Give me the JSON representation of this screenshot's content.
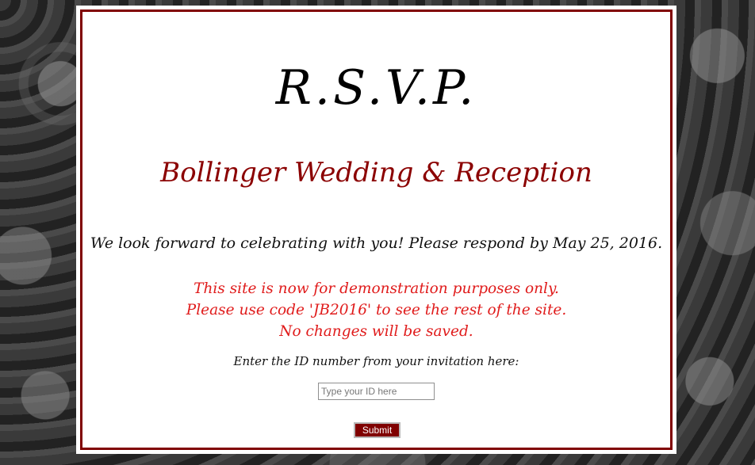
{
  "header": {
    "rsvp_title": "R.S.V.P.",
    "event_title": "Bollinger Wedding  & Reception"
  },
  "main": {
    "message": "We look forward to celebrating with you! Please respond by May 25, 2016.",
    "notice_lines": [
      "This site is now for demonstration purposes only.",
      "Please use code 'JB2016' to see the rest of the site.",
      "No changes will be saved."
    ],
    "prompt": "Enter the ID number from your invitation here:"
  },
  "form": {
    "id_input": {
      "value": "",
      "placeholder": "Type your ID here"
    },
    "submit_label": "Submit"
  },
  "colors": {
    "frame": "#800000",
    "event_title": "#8b0000",
    "notice": "#e01b1b",
    "button": "#800000"
  }
}
